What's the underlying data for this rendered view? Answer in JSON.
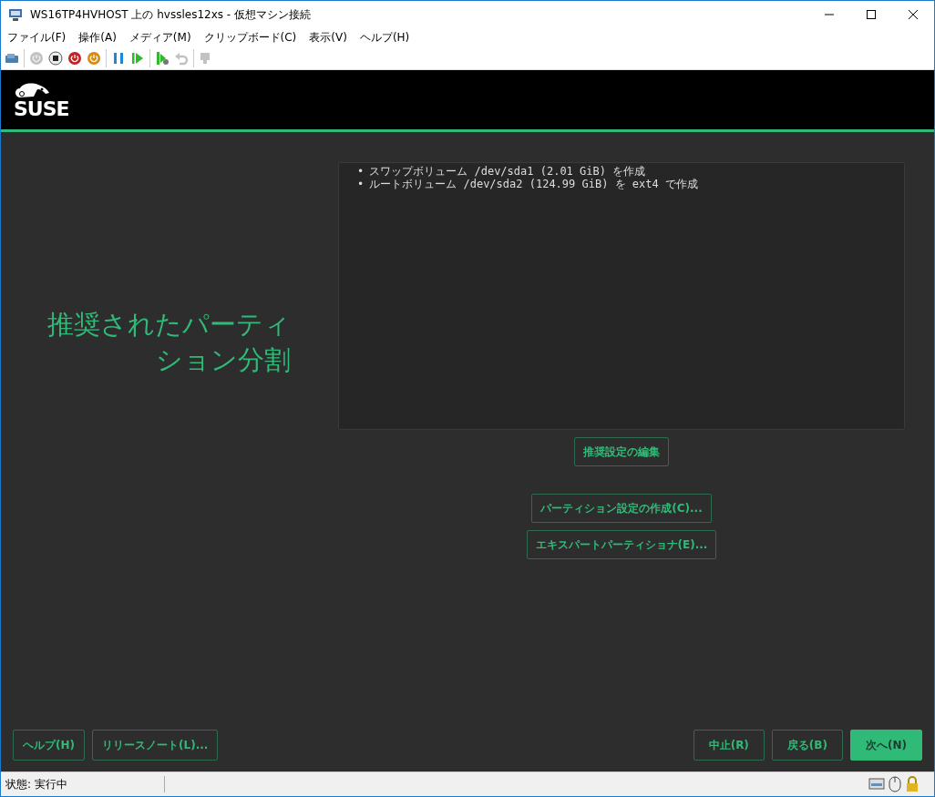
{
  "window": {
    "title": "WS16TP4HVHOST 上の hvssles12xs - 仮想マシン接続"
  },
  "menu": [
    "ファイル(F)",
    "操作(A)",
    "メディア(M)",
    "クリップボード(C)",
    "表示(V)",
    "ヘルプ(H)"
  ],
  "toolbar": [
    {
      "kind": "ctrl-alt-del",
      "disabled": false
    },
    {
      "kind": "sep"
    },
    {
      "kind": "start",
      "disabled": true
    },
    {
      "kind": "stop",
      "disabled": false
    },
    {
      "kind": "shutdown",
      "disabled": false
    },
    {
      "kind": "power",
      "disabled": false
    },
    {
      "kind": "sep"
    },
    {
      "kind": "pause",
      "disabled": false
    },
    {
      "kind": "resume",
      "disabled": false
    },
    {
      "kind": "sep"
    },
    {
      "kind": "checkpoint",
      "disabled": false
    },
    {
      "kind": "revert",
      "disabled": true
    },
    {
      "kind": "sep"
    },
    {
      "kind": "session",
      "disabled": true
    }
  ],
  "logo": "SUSE",
  "heading": "推奨されたパーティション分割",
  "proposal": [
    {
      "marker": "•",
      "text": "スワップボリューム /dev/sda1 (2.01 GiB) を作成"
    },
    {
      "marker": "•",
      "text": "ルートボリューム /dev/sda2 (124.99 GiB) を ext4 で作成"
    }
  ],
  "edit_button": "推奨設定の編集",
  "actions": [
    "パーティション設定の作成(C)...",
    "エキスパートパーティショナ(E)..."
  ],
  "footer_left": [
    "ヘルプ(H)",
    "リリースノート(L)..."
  ],
  "footer_right": [
    {
      "label": "中止(R)",
      "primary": false
    },
    {
      "label": "戻る(B)",
      "primary": false
    },
    {
      "label": "次へ(N)",
      "primary": true
    }
  ],
  "status_bar": {
    "text": "状態: 実行中"
  }
}
